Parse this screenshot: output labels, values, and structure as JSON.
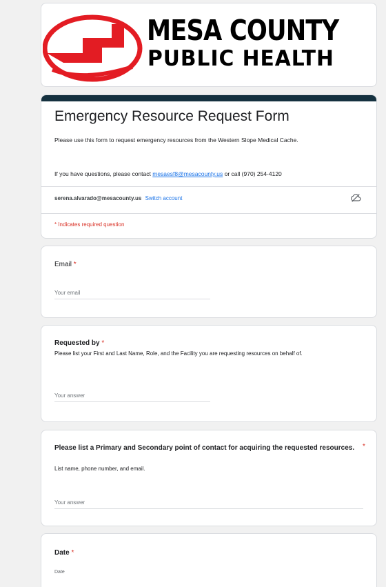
{
  "header": {
    "logo_line1": "MESA COUNTY",
    "logo_line2": "PUBLIC HEALTH",
    "logo_color": "#e31c23"
  },
  "form": {
    "title": "Emergency Resource Request Form",
    "description": "Please use this form to request emergency resources from the Western Slope Medical Cache.",
    "contact_prefix": "If you have questions, please contact ",
    "contact_email": "mesaesf8@mesacounty.us",
    "contact_suffix": " or call (970) 254-4120",
    "account_email": "serena.alvarado@mesacounty.us",
    "switch_account": "Switch account",
    "cloud_icon": "cloud-off-icon",
    "required_note": "* Indicates required question",
    "accent_color": "#15313f"
  },
  "questions": {
    "email": {
      "label": "Email",
      "required_mark": "*",
      "placeholder": "Your email"
    },
    "requested_by": {
      "label": "Requested by",
      "required_mark": "*",
      "help": "Please list your First and Last Name, Role, and the Facility you are requesting resources on behalf of.",
      "placeholder": "Your answer"
    },
    "points_of_contact": {
      "label": "Please list a Primary and Secondary point of contact for acquiring the requested resources.",
      "required_mark": "*",
      "help": "List name, phone number, and email.",
      "placeholder": "Your answer"
    },
    "date": {
      "label": "Date",
      "required_mark": "*",
      "sub_label": "Date"
    }
  }
}
